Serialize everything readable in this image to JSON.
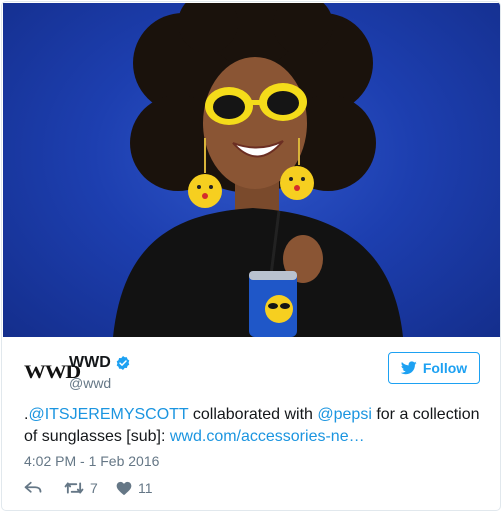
{
  "tweet": {
    "logo_text": "WWD",
    "author_name": "WWD",
    "author_handle": "@wwd",
    "follow_label": "Follow",
    "text": {
      "prefix": ".",
      "mention1": "@ITSJEREMYSCOTT",
      "middle": " collaborated with ",
      "mention2": "@pepsi",
      "rest": " for a collection of sunglasses [sub]: ",
      "url": "wwd.com/accessories-ne…"
    },
    "timestamp": "4:02 PM - 1 Feb 2016",
    "retweet_count": "7",
    "like_count": "11"
  },
  "colors": {
    "accent": "#1da1f2",
    "link": "#1b95e0",
    "muted": "#657786",
    "photo_background": "#1d3fb0"
  },
  "icons": [
    "verified-badge-icon",
    "twitter-bird-icon",
    "reply-icon",
    "retweet-icon",
    "heart-icon"
  ]
}
